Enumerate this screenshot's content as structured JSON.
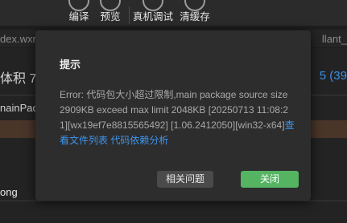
{
  "toolbar": {
    "items": [
      {
        "label": "编译"
      },
      {
        "label": "预览"
      },
      {
        "label": "真机调试"
      },
      {
        "label": "清缓存"
      }
    ]
  },
  "background": {
    "tab_left": "dex.wxm",
    "tab_right": "llant_",
    "left_text": "体积  7.",
    "right_number": "5 (39",
    "row2_text": "nainPack",
    "row3_text": "ong"
  },
  "dialog": {
    "title": "提示",
    "message": "Error: 代码包大小超过限制,main package source size 2909KB exceed max limit 2048KB [20250713 11:08:21][wx19ef7e8815565492] [1.06.2412050][win32-x64]",
    "link_files": "查看文件列表",
    "link_deps": "代码依赖分析",
    "buttons": {
      "related": "相关问题",
      "close": "关闭"
    }
  }
}
